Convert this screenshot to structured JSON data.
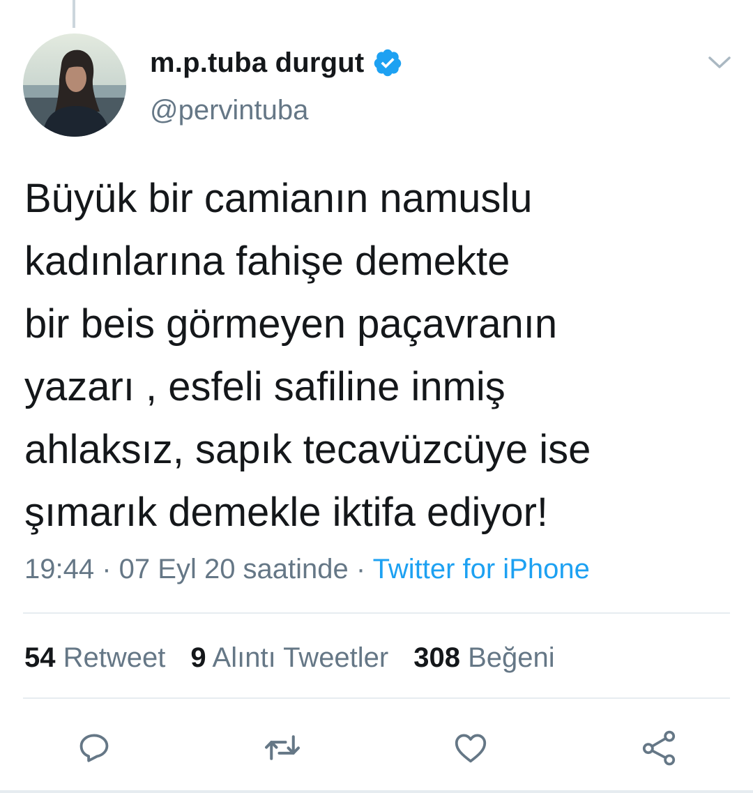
{
  "author": {
    "display_name": "m.p.tuba durgut",
    "handle": "@pervintuba",
    "verified": true
  },
  "tweet": {
    "lines": [
      "Büyük bir camianın namuslu",
      "kadınlarına fahişe demekte",
      "bir beis görmeyen paçavranın",
      "yazarı , esfeli safiline inmiş",
      "ahlaksız, sapık tecavüzcüye ise",
      "şımarık demekle iktifa ediyor!"
    ]
  },
  "meta": {
    "time": "19:44",
    "separator_1": " · ",
    "date": "07 Eyl 20 saatinde",
    "separator_2": " · ",
    "source": "Twitter for iPhone"
  },
  "stats": {
    "retweets": {
      "count": "54",
      "label": "Retweet"
    },
    "quotes": {
      "count": "9",
      "label": "Alıntı Tweetler"
    },
    "likes": {
      "count": "308",
      "label": "Beğeni"
    }
  },
  "actions": {
    "reply_icon": "reply-icon",
    "retweet_icon": "retweet-icon",
    "like_icon": "heart-icon",
    "share_icon": "share-icon"
  },
  "colors": {
    "text_primary": "#14171a",
    "text_secondary": "#657786",
    "link": "#1da1f2",
    "verified_badge": "#1da1f2",
    "divider": "#e6ecf0"
  }
}
